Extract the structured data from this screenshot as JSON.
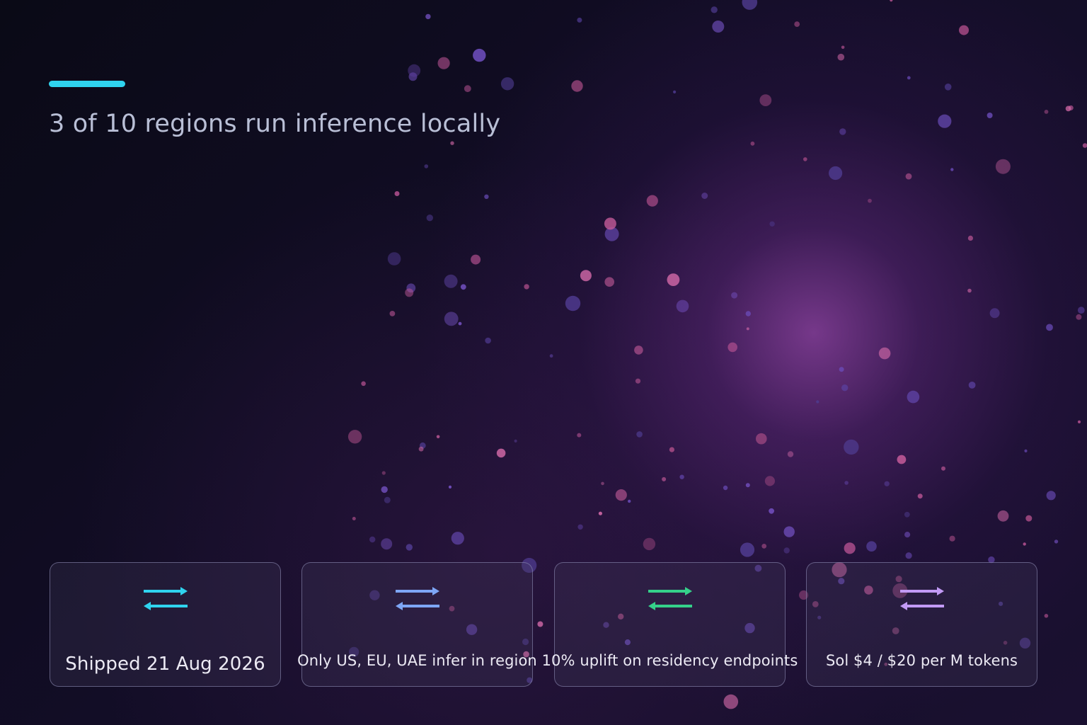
{
  "slide": {
    "headline": "3 of 10 regions run inference locally",
    "accent_color": "#2fd3ee"
  },
  "cards": [
    {
      "text": "Shipped 21 Aug 2026",
      "icon": "swap-arrows-icon",
      "icon_color": "#2fd3ee"
    },
    {
      "text": "Only US, EU, UAE infer in region",
      "icon": "swap-arrows-icon",
      "icon_color": "#7ea6f5"
    },
    {
      "text": "10% uplift on residency endpoints",
      "icon": "swap-arrows-icon",
      "icon_color": "#35d08a"
    },
    {
      "text": "Sol $4 / $20 per M tokens",
      "icon": "swap-arrows-icon",
      "icon_color": "#c29af5"
    }
  ]
}
